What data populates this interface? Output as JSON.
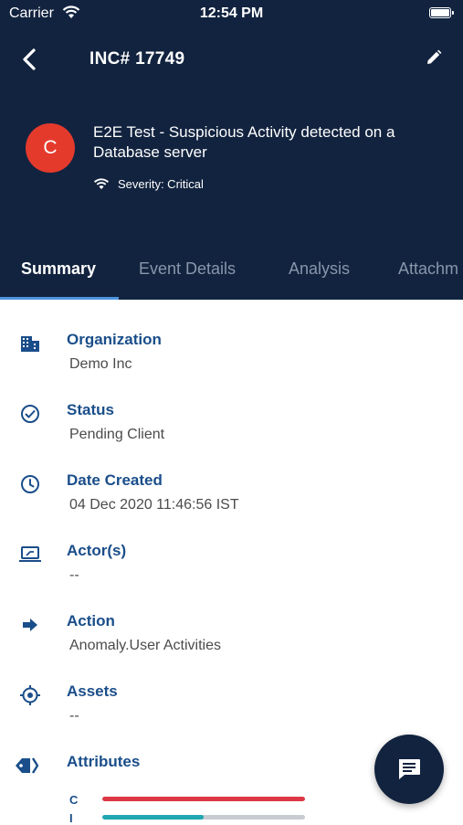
{
  "status_bar": {
    "carrier": "Carrier",
    "time": "12:54 PM"
  },
  "header": {
    "title": "INC# 17749",
    "avatar_letter": "C",
    "incident_title": "E2E Test - Suspicious Activity detected on a Database server",
    "severity": "Severity: Critical"
  },
  "tabs": [
    {
      "label": "Summary",
      "active": true
    },
    {
      "label": "Event Details",
      "active": false
    },
    {
      "label": "Analysis",
      "active": false
    },
    {
      "label": "Attachm",
      "active": false
    }
  ],
  "fields": [
    {
      "label": "Organization",
      "value": "Demo Inc",
      "icon": "building-icon"
    },
    {
      "label": "Status",
      "value": "Pending Client",
      "icon": "check-circle-icon"
    },
    {
      "label": "Date Created",
      "value": "04 Dec 2020 11:46:56 IST",
      "icon": "clock-icon"
    },
    {
      "label": "Actor(s)",
      "value": "--",
      "icon": "laptop-icon"
    },
    {
      "label": "Action",
      "value": "Anomaly.User Activities",
      "icon": "arrow-right-icon"
    },
    {
      "label": "Assets",
      "value": "--",
      "icon": "target-icon"
    },
    {
      "label": "Attributes",
      "value": "",
      "icon": "tag-icon"
    }
  ],
  "attributes": [
    {
      "letter": "C",
      "level": 1.0,
      "color": "#de3745"
    },
    {
      "letter": "I",
      "level": 0.5,
      "color": "#1fa7b2"
    }
  ],
  "colors": {
    "header_bg": "#12233f",
    "accent": "#4f92e0",
    "label": "#1a4e8a",
    "avatar": "#e43a2c"
  },
  "fab_icon": "chat-icon"
}
